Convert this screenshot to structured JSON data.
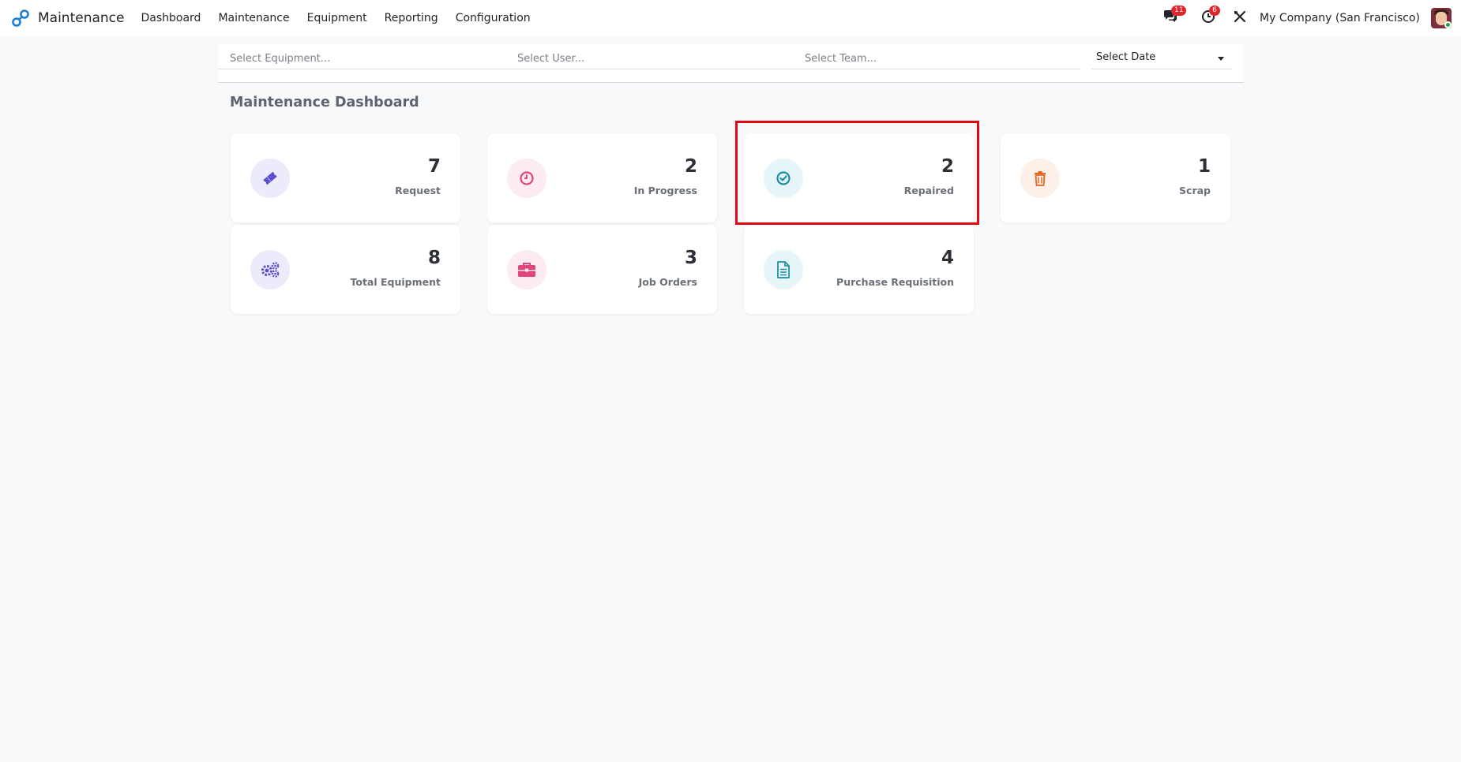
{
  "app": {
    "name": "Maintenance",
    "logo_icon": "odoo-link-logo-icon"
  },
  "menu": [
    {
      "label": "Dashboard"
    },
    {
      "label": "Maintenance"
    },
    {
      "label": "Equipment"
    },
    {
      "label": "Reporting"
    },
    {
      "label": "Configuration"
    }
  ],
  "systray": {
    "messages_badge": "11",
    "activities_badge": "6",
    "company": "My Company (San Francisco)"
  },
  "filters": {
    "equipment_placeholder": "Select Equipment...",
    "user_placeholder": "Select User...",
    "team_placeholder": "Select Team...",
    "date_value": "Select Date"
  },
  "dashboard": {
    "title": "Maintenance Dashboard",
    "cards": [
      {
        "value": "7",
        "label": "Request",
        "icon": "ticket-icon",
        "color": "#5a4fcf",
        "bg": "#ecebfb"
      },
      {
        "value": "2",
        "label": "In Progress",
        "icon": "clock-icon",
        "color": "#e0457b",
        "bg": "#fcebf1"
      },
      {
        "value": "2",
        "label": "Repaired",
        "icon": "check-circle-icon",
        "color": "#1a8fa3",
        "bg": "#e6f6f8"
      },
      {
        "value": "1",
        "label": "Scrap",
        "icon": "trash-icon",
        "color": "#e8671f",
        "bg": "#fdf0e8"
      },
      {
        "value": "8",
        "label": "Total Equipment",
        "icon": "gears-icon",
        "color": "#5a4fcf",
        "bg": "#ecebfb"
      },
      {
        "value": "3",
        "label": "Job Orders",
        "icon": "briefcase-icon",
        "color": "#e0457b",
        "bg": "#fcebf1"
      },
      {
        "value": "4",
        "label": "Purchase Requisition",
        "icon": "document-icon",
        "color": "#1a8fa3",
        "bg": "#e6f6f8"
      }
    ]
  },
  "highlight_color": "#e30613"
}
